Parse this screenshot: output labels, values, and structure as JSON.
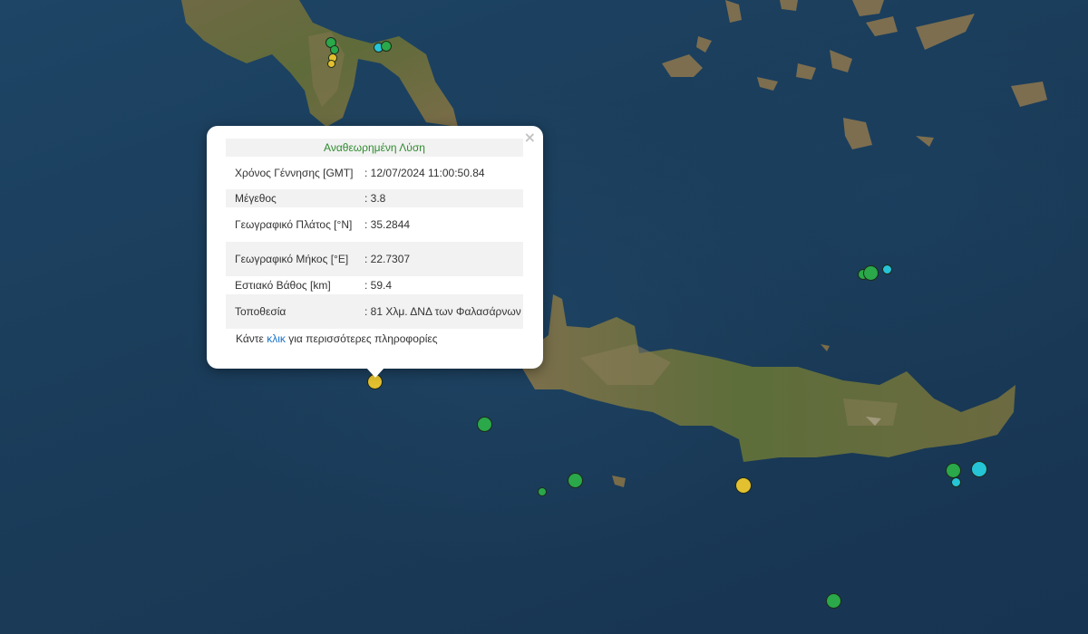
{
  "popup": {
    "title": "Αναθεωρημένη Λύση",
    "rows": [
      {
        "label": "Χρόνος Γέννησης [GMT]",
        "value": ": 12/07/2024 11:00:50.84"
      },
      {
        "label": "Μέγεθος",
        "value": ": 3.8"
      },
      {
        "label": "Γεωγραφικό Πλάτος [°N]",
        "value": ": 35.2844"
      },
      {
        "label": "Γεωγραφικό Μήκος [°E]",
        "value": ": 22.7307"
      },
      {
        "label": "Εστιακό Βάθος [km]",
        "value": ": 59.4"
      },
      {
        "label": "Τοποθεσία",
        "value": ": 81 Χλμ. ΔΝΔ των Φαλασάρνων"
      }
    ],
    "more_prefix": "Κάντε ",
    "more_link": "κλικ",
    "more_suffix": " για περισσότερες πληροφορίες",
    "close_symbol": "×"
  },
  "colors": {
    "quake_green": "#2aa84a",
    "quake_yellow": "#e3c02f",
    "quake_cyan": "#25c4d6",
    "title_green": "#2e8b2e",
    "link_blue": "#1a73c8"
  },
  "markers": [
    {
      "color": "green"
    },
    {
      "color": "green"
    },
    {
      "color": "yellow"
    },
    {
      "color": "yellow"
    },
    {
      "color": "cyan"
    },
    {
      "color": "green"
    },
    {
      "color": "yellow"
    },
    {
      "color": "green"
    },
    {
      "color": "green"
    },
    {
      "color": "green"
    },
    {
      "color": "yellow"
    },
    {
      "color": "green"
    },
    {
      "color": "cyan"
    },
    {
      "color": "cyan"
    },
    {
      "color": "green"
    },
    {
      "color": "green"
    },
    {
      "color": "cyan"
    },
    {
      "color": "green"
    }
  ]
}
